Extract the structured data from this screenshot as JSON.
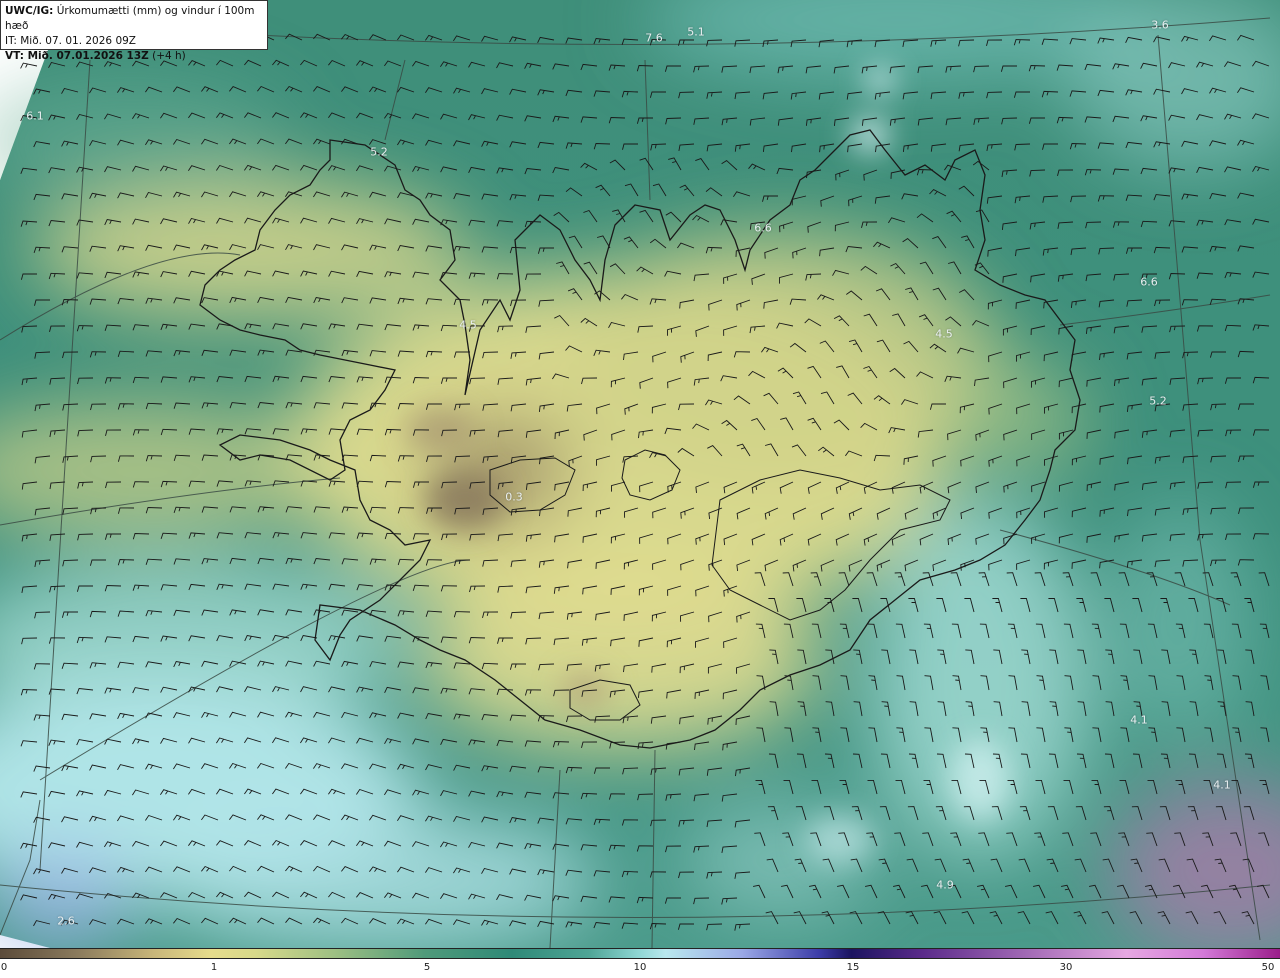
{
  "header": {
    "model_prefix": "UWC/IG:",
    "title": "Úrkomumætti (mm) og vindur í 100m hæð",
    "it_line": "IT: Mið. 07. 01. 2026 09Z",
    "vt_prefix": "VT: Mið. 07.01.2026 13Z",
    "vt_suffix": " (+4 h)"
  },
  "colorbar": {
    "tick_labels": [
      "0",
      "1",
      "5",
      "10",
      "15",
      "30",
      "50"
    ]
  },
  "map_labels": [
    {
      "text": "7.6"
    },
    {
      "text": "5.1"
    },
    {
      "text": "3.6"
    },
    {
      "text": "6.1"
    },
    {
      "text": "5.2"
    },
    {
      "text": "6.6"
    },
    {
      "text": "6.6"
    },
    {
      "text": "4.5"
    },
    {
      "text": "4.5"
    },
    {
      "text": "5.2"
    },
    {
      "text": "0.3"
    },
    {
      "text": "4.1"
    },
    {
      "text": "4.1"
    },
    {
      "text": "4.9"
    },
    {
      "text": "2.6"
    }
  ],
  "colors": {
    "dry": "#8a7a5c",
    "low": "#e6dc8c",
    "mid": "#2f8a78",
    "high": "#8fd6d4",
    "very_high": "#1b1460",
    "extreme": "#9a1d8a",
    "coastline": "#1a1a1a",
    "wind_barb": "#1a1a1a"
  },
  "icons": {
    "wind": "wind-barb-icon"
  }
}
